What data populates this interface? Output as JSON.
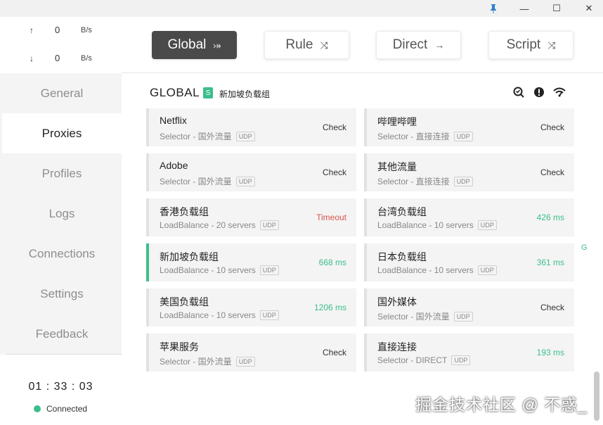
{
  "titlebar": {
    "pin_icon": "pin-icon",
    "minimize_icon": "—",
    "maximize_icon": "☐",
    "close_icon": "✕"
  },
  "traffic": {
    "up": {
      "arrow": "↑",
      "value": "0",
      "unit": "B/s"
    },
    "down": {
      "arrow": "↓",
      "value": "0",
      "unit": "B/s"
    }
  },
  "nav": {
    "items": [
      "General",
      "Proxies",
      "Profiles",
      "Logs",
      "Connections",
      "Settings",
      "Feedback"
    ],
    "active": "Proxies"
  },
  "status": {
    "timer": "01 : 33 : 03",
    "connection": "Connected",
    "connection_color": "#3bbf8a"
  },
  "modes": {
    "items": [
      {
        "label": "Global",
        "icon": "⤖"
      },
      {
        "label": "Rule",
        "icon": "⤨"
      },
      {
        "label": "Direct",
        "icon": "→"
      },
      {
        "label": "Script",
        "icon": "⤨"
      }
    ],
    "active": "Global"
  },
  "group": {
    "title": "GLOBAL",
    "badge": "S",
    "selected": "新加坡负载组",
    "icons": [
      "search-icon",
      "alert-icon",
      "wifi-speed-icon"
    ]
  },
  "proxies": [
    {
      "name": "Netflix",
      "type": "Selector - 国外流量",
      "udp": "UDP",
      "delay": "Check",
      "status": "check"
    },
    {
      "name": "哔哩哔哩",
      "type": "Selector - 直接连接",
      "udp": "UDP",
      "delay": "Check",
      "status": "check"
    },
    {
      "name": "Adobe",
      "type": "Selector - 国外流量",
      "udp": "UDP",
      "delay": "Check",
      "status": "check"
    },
    {
      "name": "其他流量",
      "type": "Selector - 直接连接",
      "udp": "UDP",
      "delay": "Check",
      "status": "check"
    },
    {
      "name": "香港负载组",
      "type": "LoadBalance - 20 servers",
      "udp": "UDP",
      "delay": "Timeout",
      "status": "timeout"
    },
    {
      "name": "台湾负载组",
      "type": "LoadBalance - 10 servers",
      "udp": "UDP",
      "delay": "426 ms",
      "status": "ok"
    },
    {
      "name": "新加坡负载组",
      "type": "LoadBalance - 10 servers",
      "udp": "UDP",
      "delay": "668 ms",
      "status": "ok",
      "selected": true
    },
    {
      "name": "日本负载组",
      "type": "LoadBalance - 10 servers",
      "udp": "UDP",
      "delay": "361 ms",
      "status": "ok"
    },
    {
      "name": "美国负载组",
      "type": "LoadBalance - 10 servers",
      "udp": "UDP",
      "delay": "1206 ms",
      "status": "ok"
    },
    {
      "name": "国外媒体",
      "type": "Selector - 国外流量",
      "udp": "UDP",
      "delay": "Check",
      "status": "check"
    },
    {
      "name": "苹果服务",
      "type": "Selector - 国外流量",
      "udp": "UDP",
      "delay": "Check",
      "status": "check"
    },
    {
      "name": "直接连接",
      "type": "Selector - DIRECT",
      "udp": "UDP",
      "delay": "193 ms",
      "status": "ok"
    }
  ],
  "edge_letter": "G",
  "watermark": "掘金技术社区 @ 不惑_",
  "colors": {
    "accent": "#3bbf8a",
    "timeout": "#d9534f",
    "active_mode_bg": "#4a4a4a"
  }
}
